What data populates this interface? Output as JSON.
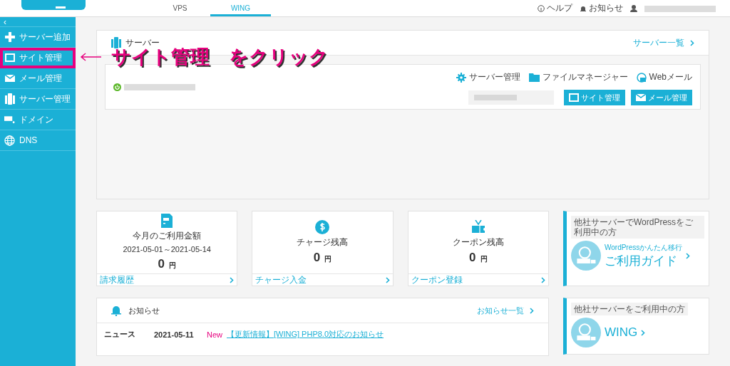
{
  "header": {
    "tabs": [
      {
        "label": "VPS",
        "selected": false
      },
      {
        "label": "WING",
        "selected": true
      }
    ],
    "links": [
      {
        "kind": "help",
        "label": "ヘルプ"
      },
      {
        "kind": "bell",
        "label": "お知らせ"
      }
    ]
  },
  "sidebar": {
    "collapse": "‹",
    "items": [
      {
        "kind": "plus",
        "label": "サーバー追加",
        "highlighted": false
      },
      {
        "kind": "window",
        "label": "サイト管理",
        "highlighted": true
      },
      {
        "kind": "mail",
        "label": "メール管理",
        "highlighted": false
      },
      {
        "kind": "server",
        "label": "サーバー管理",
        "highlighted": false
      },
      {
        "kind": "domain",
        "label": "ドメイン",
        "highlighted": false
      },
      {
        "kind": "globe",
        "label": "DNS",
        "highlighted": false
      }
    ]
  },
  "annotation": {
    "text": "サイト管理　をクリック"
  },
  "server_panel": {
    "title": "サーバー",
    "link": "サーバー一覧",
    "running": true,
    "tools": [
      {
        "kind": "gear",
        "label": "サーバー管理"
      },
      {
        "kind": "folder",
        "label": "ファイルマネージャー"
      },
      {
        "kind": "webmail",
        "label": "Webメール"
      }
    ],
    "buttons": [
      {
        "kind": "window",
        "label": "サイト管理"
      },
      {
        "kind": "mail",
        "label": "メール管理"
      }
    ]
  },
  "cards": [
    {
      "kind": "bill",
      "title": "今月のご利用金額",
      "period": "2021-05-01～2021-05-14",
      "amount": "0",
      "unit": "円",
      "link": "請求履歴"
    },
    {
      "kind": "dollar",
      "title": "チャージ残高",
      "amount": "0",
      "unit": "円",
      "link": "チャージ入金"
    },
    {
      "kind": "coupon",
      "title": "クーポン残高",
      "amount": "0",
      "unit": "円",
      "link": "クーポン登録"
    }
  ],
  "notices": {
    "title": "お知らせ",
    "link": "お知らせ一覧",
    "items": [
      {
        "category": "ニュース",
        "date": "2021-05-11",
        "badge": "New",
        "text": "【更新情報】[WING] PHP8.0対応のお知らせ"
      }
    ]
  },
  "banners": [
    {
      "caption": "他社サーバーでWordPressをご利用中の方",
      "lead": "WordPressかんたん移行",
      "headline": "ご利用ガイド"
    },
    {
      "caption": "他社サーバーをご利用中の方",
      "headline": "WING"
    }
  ]
}
